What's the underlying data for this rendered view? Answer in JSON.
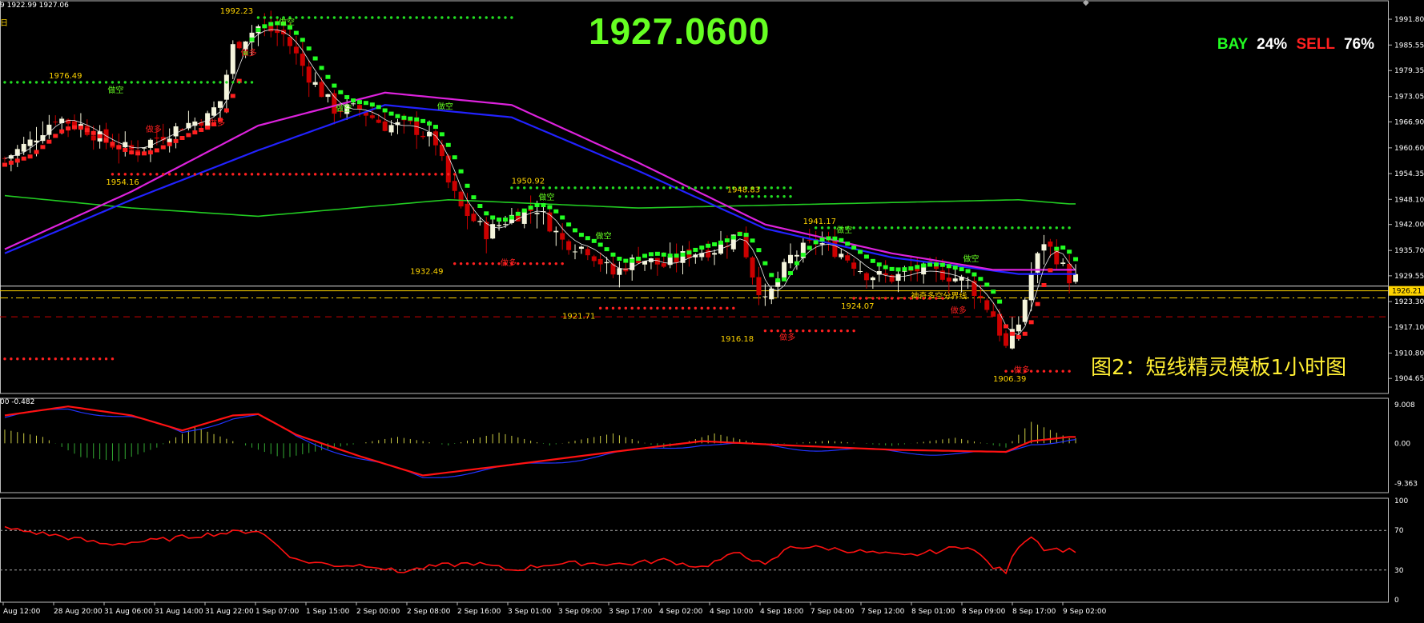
{
  "header": {
    "ohlc_text": "9 1922.99 1927.06",
    "timeframe": "日",
    "current_price": "1927.0600",
    "buy_label": "BAY",
    "buy_pct": "24%",
    "sell_label": "SELL",
    "sell_pct": "76%",
    "caption": "图2：短线精灵模板1小时图",
    "macd_label": "00 -0.482",
    "current_price_tag": "1926.21",
    "divider_label": "神奇多空分界线"
  },
  "colors": {
    "background": "#000000",
    "bull_candle": "#f5f5dc",
    "bear_candle": "#cc0000",
    "green_accent": "#66ff22",
    "red_accent": "#ff2020",
    "ma_blue": "#2222ff",
    "ma_magenta": "#dd22dd",
    "ma_green": "#22cc22"
  },
  "chart_data": [
    {
      "type": "candlestick",
      "title": "",
      "ylim": [
        1901.0,
        1995.5
      ],
      "y_ticks": [
        "1991.80",
        "1985.55",
        "1979.35",
        "1973.05",
        "1966.90",
        "1960.60",
        "1954.35",
        "1948.10",
        "1942.00",
        "1935.70",
        "1929.55",
        "1923.30",
        "1917.10",
        "1910.80",
        "1904.65"
      ],
      "x_ticks": [
        "Aug 12:00",
        "28 Aug 20:00",
        "31 Aug 06:00",
        "31 Aug 14:00",
        "31 Aug 22:00",
        "1 Sep 07:00",
        "1 Sep 15:00",
        "2 Sep 00:00",
        "2 Sep 08:00",
        "2 Sep 16:00",
        "3 Sep 01:00",
        "3 Sep 09:00",
        "3 Sep 17:00",
        "4 Sep 02:00",
        "4 Sep 10:00",
        "4 Sep 18:00",
        "7 Sep 04:00",
        "7 Sep 12:00",
        "8 Sep 01:00",
        "8 Sep 09:00",
        "8 Sep 17:00",
        "9 Sep 02:00"
      ],
      "price_labels": [
        {
          "text": "1992.23",
          "i": 36,
          "price": 1992.23,
          "pos": "above"
        },
        {
          "text": "1976.49",
          "i": 9,
          "price": 1976.49,
          "pos": "above"
        },
        {
          "text": "1954.16",
          "i": 18,
          "price": 1954.16,
          "pos": "below"
        },
        {
          "text": "1950.92",
          "i": 82,
          "price": 1950.92,
          "pos": "above"
        },
        {
          "text": "1948.83",
          "i": 116,
          "price": 1948.83,
          "pos": "above"
        },
        {
          "text": "1941.17",
          "i": 128,
          "price": 1941.17,
          "pos": "above"
        },
        {
          "text": "1932.49",
          "i": 66,
          "price": 1932.49,
          "pos": "below"
        },
        {
          "text": "1921.71",
          "i": 90,
          "price": 1921.71,
          "pos": "below"
        },
        {
          "text": "1916.18",
          "i": 115,
          "price": 1916.18,
          "pos": "below"
        },
        {
          "text": "1924.07",
          "i": 134,
          "price": 1924.07,
          "pos": "below"
        },
        {
          "text": "1906.39",
          "i": 158,
          "price": 1906.39,
          "pos": "below"
        }
      ],
      "signal_labels": [
        {
          "text": "做空",
          "i": 17,
          "price": 1974.0,
          "color": "#66ff22"
        },
        {
          "text": "做空",
          "i": 44,
          "price": 1990.5,
          "color": "#66ff22"
        },
        {
          "text": "做空",
          "i": 53,
          "price": 1969.5,
          "color": "#66ff22"
        },
        {
          "text": "做空",
          "i": 69,
          "price": 1970.0,
          "color": "#66ff22"
        },
        {
          "text": "做空",
          "i": 85,
          "price": 1948.0,
          "color": "#66ff22"
        },
        {
          "text": "做空",
          "i": 94,
          "price": 1938.5,
          "color": "#66ff22"
        },
        {
          "text": "做空",
          "i": 132,
          "price": 1940.0,
          "color": "#66ff22"
        },
        {
          "text": "做空",
          "i": 152,
          "price": 1933.0,
          "color": "#66ff22"
        },
        {
          "text": "做多",
          "i": 38,
          "price": 1983.0,
          "color": "#ff2020"
        },
        {
          "text": "做多",
          "i": 33,
          "price": 1966.0,
          "color": "#ff2020"
        },
        {
          "text": "做多",
          "i": 23,
          "price": 1964.5,
          "color": "#ff2020"
        },
        {
          "text": "做多",
          "i": 79,
          "price": 1932.0,
          "color": "#ff2020"
        },
        {
          "text": "做多",
          "i": 123,
          "price": 1914.0,
          "color": "#ff2020"
        },
        {
          "text": "做多",
          "i": 150,
          "price": 1920.5,
          "color": "#ff2020"
        },
        {
          "text": "做多",
          "i": 160,
          "price": 1906.0,
          "color": "#ff2020"
        }
      ],
      "dotted_levels": [
        {
          "price": 1992.2,
          "from": 40,
          "to": 80,
          "color": "#22dd22"
        },
        {
          "price": 1976.5,
          "from": 0,
          "to": 39,
          "color": "#22dd22"
        },
        {
          "price": 1950.9,
          "from": 80,
          "to": 124,
          "color": "#22dd22"
        },
        {
          "price": 1948.8,
          "from": 116,
          "to": 124,
          "color": "#22dd22"
        },
        {
          "price": 1941.2,
          "from": 128,
          "to": 168,
          "color": "#22dd22"
        },
        {
          "price": 1954.2,
          "from": 17,
          "to": 71,
          "color": "#ff2020"
        },
        {
          "price": 1932.5,
          "from": 71,
          "to": 88,
          "color": "#ff2020"
        },
        {
          "price": 1921.7,
          "from": 94,
          "to": 115,
          "color": "#ff2020"
        },
        {
          "price": 1916.2,
          "from": 120,
          "to": 134,
          "color": "#ff2020"
        },
        {
          "price": 1924.1,
          "from": 134,
          "to": 148,
          "color": "#ff2020"
        },
        {
          "price": 1909.4,
          "from": 0,
          "to": 17,
          "color": "#ff2020"
        },
        {
          "price": 1906.4,
          "from": 158,
          "to": 168,
          "color": "#ff2020"
        }
      ],
      "horizontal_lines": [
        {
          "price": 1927.06,
          "color": "#dddddd",
          "style": "solid"
        },
        {
          "price": 1925.9,
          "color": "#ffd400",
          "style": "solid"
        },
        {
          "price": 1924.2,
          "color": "#ffd400",
          "style": "dashdot"
        },
        {
          "price": 1919.6,
          "color": "#cc0000",
          "style": "dashed"
        }
      ],
      "candles_count": 170,
      "anchors": [
        [
          0,
          1958
        ],
        [
          4,
          1962
        ],
        [
          8,
          1968
        ],
        [
          12,
          1966
        ],
        [
          16,
          1962
        ],
        [
          20,
          1960
        ],
        [
          24,
          1963
        ],
        [
          28,
          1966
        ],
        [
          32,
          1968
        ],
        [
          34,
          1972
        ],
        [
          36,
          1985
        ],
        [
          40,
          1990
        ],
        [
          44,
          1988
        ],
        [
          48,
          1978
        ],
        [
          52,
          1970
        ],
        [
          56,
          1970
        ],
        [
          60,
          1966
        ],
        [
          64,
          1966
        ],
        [
          68,
          1962
        ],
        [
          70,
          1952
        ],
        [
          72,
          1946
        ],
        [
          76,
          1940
        ],
        [
          80,
          1944
        ],
        [
          84,
          1946
        ],
        [
          88,
          1938
        ],
        [
          92,
          1936
        ],
        [
          96,
          1930
        ],
        [
          100,
          1934
        ],
        [
          104,
          1932
        ],
        [
          108,
          1935
        ],
        [
          112,
          1936
        ],
        [
          116,
          1940
        ],
        [
          118,
          1930
        ],
        [
          120,
          1923
        ],
        [
          124,
          1934
        ],
        [
          128,
          1938
        ],
        [
          132,
          1935
        ],
        [
          136,
          1930
        ],
        [
          140,
          1929
        ],
        [
          144,
          1931
        ],
        [
          148,
          1930
        ],
        [
          152,
          1928
        ],
        [
          156,
          1920
        ],
        [
          158,
          1912
        ],
        [
          160,
          1918
        ],
        [
          162,
          1930
        ],
        [
          164,
          1938
        ],
        [
          166,
          1934
        ],
        [
          168,
          1929
        ]
      ],
      "ma_green_anchors": [
        [
          0,
          1949
        ],
        [
          20,
          1946
        ],
        [
          40,
          1944
        ],
        [
          70,
          1948
        ],
        [
          100,
          1946
        ],
        [
          130,
          1947
        ],
        [
          160,
          1948
        ],
        [
          168,
          1947
        ]
      ],
      "ma_blue_anchors": [
        [
          0,
          1935
        ],
        [
          20,
          1948
        ],
        [
          40,
          1960
        ],
        [
          60,
          1971
        ],
        [
          80,
          1968
        ],
        [
          100,
          1955
        ],
        [
          120,
          1941
        ],
        [
          140,
          1934
        ],
        [
          160,
          1930
        ],
        [
          168,
          1930
        ]
      ],
      "ma_magenta_anchors": [
        [
          0,
          1936
        ],
        [
          20,
          1950
        ],
        [
          40,
          1966
        ],
        [
          60,
          1974
        ],
        [
          80,
          1971
        ],
        [
          100,
          1957
        ],
        [
          120,
          1942
        ],
        [
          140,
          1935
        ],
        [
          156,
          1931
        ],
        [
          168,
          1931
        ]
      ]
    },
    {
      "type": "macd",
      "title": "",
      "ylim": [
        -11.5,
        10.5
      ],
      "y_ticks": [
        "9.008",
        "0.00",
        "-9.363"
      ],
      "signal_anchors": [
        [
          0,
          6.5
        ],
        [
          10,
          8.6
        ],
        [
          20,
          6.5
        ],
        [
          28,
          3
        ],
        [
          36,
          6.5
        ],
        [
          40,
          6.8
        ],
        [
          46,
          2
        ],
        [
          56,
          -3
        ],
        [
          66,
          -7.5
        ],
        [
          80,
          -5
        ],
        [
          96,
          -2
        ],
        [
          110,
          0.5
        ],
        [
          124,
          -0.5
        ],
        [
          140,
          -1.5
        ],
        [
          158,
          -2
        ],
        [
          162,
          0.5
        ],
        [
          168,
          1.5
        ]
      ],
      "hist_anchors": [
        [
          0,
          3.2
        ],
        [
          6,
          1.5
        ],
        [
          12,
          -3.2
        ],
        [
          18,
          -4.2
        ],
        [
          24,
          -1
        ],
        [
          30,
          3.8
        ],
        [
          36,
          0.5
        ],
        [
          44,
          -3.5
        ],
        [
          52,
          -1
        ],
        [
          62,
          1.5
        ],
        [
          70,
          -0.5
        ],
        [
          78,
          2.5
        ],
        [
          86,
          -0.5
        ],
        [
          96,
          2.3
        ],
        [
          104,
          -1.2
        ],
        [
          112,
          2.3
        ],
        [
          120,
          -0.4
        ],
        [
          130,
          0.6
        ],
        [
          140,
          -0.6
        ],
        [
          150,
          1.3
        ],
        [
          158,
          -1
        ],
        [
          162,
          5
        ],
        [
          168,
          1.2
        ]
      ]
    },
    {
      "type": "oscillator",
      "title": "",
      "ylim": [
        0,
        100
      ],
      "y_ticks": [
        "100",
        "70",
        "30",
        "0"
      ],
      "levels": [
        70,
        30
      ],
      "anchors": [
        [
          0,
          72
        ],
        [
          8,
          65
        ],
        [
          16,
          56
        ],
        [
          24,
          60
        ],
        [
          32,
          66
        ],
        [
          40,
          70
        ],
        [
          46,
          40
        ],
        [
          52,
          35
        ],
        [
          58,
          35
        ],
        [
          62,
          28
        ],
        [
          68,
          34
        ],
        [
          74,
          37
        ],
        [
          80,
          30
        ],
        [
          86,
          36
        ],
        [
          92,
          37
        ],
        [
          98,
          36
        ],
        [
          104,
          40
        ],
        [
          110,
          33
        ],
        [
          116,
          48
        ],
        [
          120,
          34
        ],
        [
          124,
          54
        ],
        [
          130,
          52
        ],
        [
          136,
          48
        ],
        [
          142,
          44
        ],
        [
          148,
          50
        ],
        [
          152,
          55
        ],
        [
          156,
          33
        ],
        [
          158,
          28
        ],
        [
          160,
          55
        ],
        [
          162,
          65
        ],
        [
          164,
          52
        ],
        [
          168,
          50
        ]
      ]
    }
  ]
}
